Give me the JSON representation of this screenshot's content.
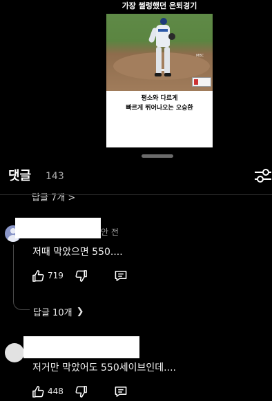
{
  "video": {
    "title": "가장 썰렁했던 은퇴경기",
    "broadcaster": "MBC",
    "caption_line1": "평소와 다르게",
    "caption_line2": "빠르게 뛰어나오는 오승환"
  },
  "comments_header": {
    "title": "댓글",
    "count": "143"
  },
  "partial_replies": "답글 7개 >",
  "comments": [
    {
      "time": "안 전",
      "text": "저때 막았으면 550....",
      "likes": "719",
      "replies_label": "답글 10개"
    },
    {
      "text": "저거만 막았어도 550세이브인데....",
      "likes": "448"
    }
  ],
  "colors": {
    "background": "#000000",
    "text": "#f1f1f1",
    "muted": "#9a9a9a",
    "avatar": "#8a96c8"
  }
}
